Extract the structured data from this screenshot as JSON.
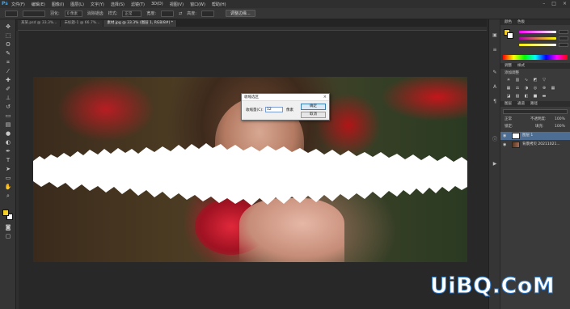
{
  "app": {
    "logo": "Ps"
  },
  "menu": [
    "文件(F)",
    "编辑(E)",
    "图像(I)",
    "图层(L)",
    "文字(Y)",
    "选择(S)",
    "滤镜(T)",
    "3D(D)",
    "视图(V)",
    "窗口(W)",
    "帮助(H)"
  ],
  "options": {
    "feather_label": "羽化:",
    "feather_value": "0 像素",
    "antialias_label": "消除锯齿",
    "style_label": "样式:",
    "style_value": "正常",
    "width_label": "宽度:",
    "height_label": "高度:",
    "refine_button": "调整边缘..."
  },
  "tabs": [
    "某某.psd @ 33.3%...",
    "未标题-1 @ 66.7%...",
    "素材.jpg @ 33.3% (图层 1, RGB/8#) *"
  ],
  "dialog": {
    "title": "收缩选区",
    "label": "收缩量(C):",
    "value": "12",
    "unit": "像素",
    "ok": "确定",
    "cancel": "取消"
  },
  "panels": {
    "color_tab": "颜色",
    "swatches_tab": "色板",
    "adjust_tab": "调整",
    "styles_tab": "样式",
    "adjust_title": "添加调整",
    "layers_tab": "图层",
    "channels_tab": "通道",
    "paths_tab": "路径",
    "mode": "正常",
    "opacity_label": "不透明度:",
    "opacity": "100%",
    "lock_label": "锁定:",
    "fill_label": "填充:",
    "fill": "100%",
    "layers": [
      "图层 1",
      "背景拷贝 20211021..."
    ]
  },
  "watermark": "UiBQ.CoM",
  "colors": {
    "fg": "#f2d028",
    "bg": "#ffffff",
    "accent": "#31a8ff",
    "selection": "#4d6e92"
  },
  "icons": [
    "move-icon",
    "marquee-icon",
    "lasso-icon",
    "quick-select-icon",
    "crop-icon",
    "eyedropper-icon",
    "healing-icon",
    "brush-icon",
    "stamp-icon",
    "history-brush-icon",
    "eraser-icon",
    "gradient-icon",
    "blur-icon",
    "dodge-icon",
    "pen-icon",
    "type-icon",
    "path-select-icon",
    "shape-icon",
    "hand-icon",
    "zoom-icon"
  ]
}
